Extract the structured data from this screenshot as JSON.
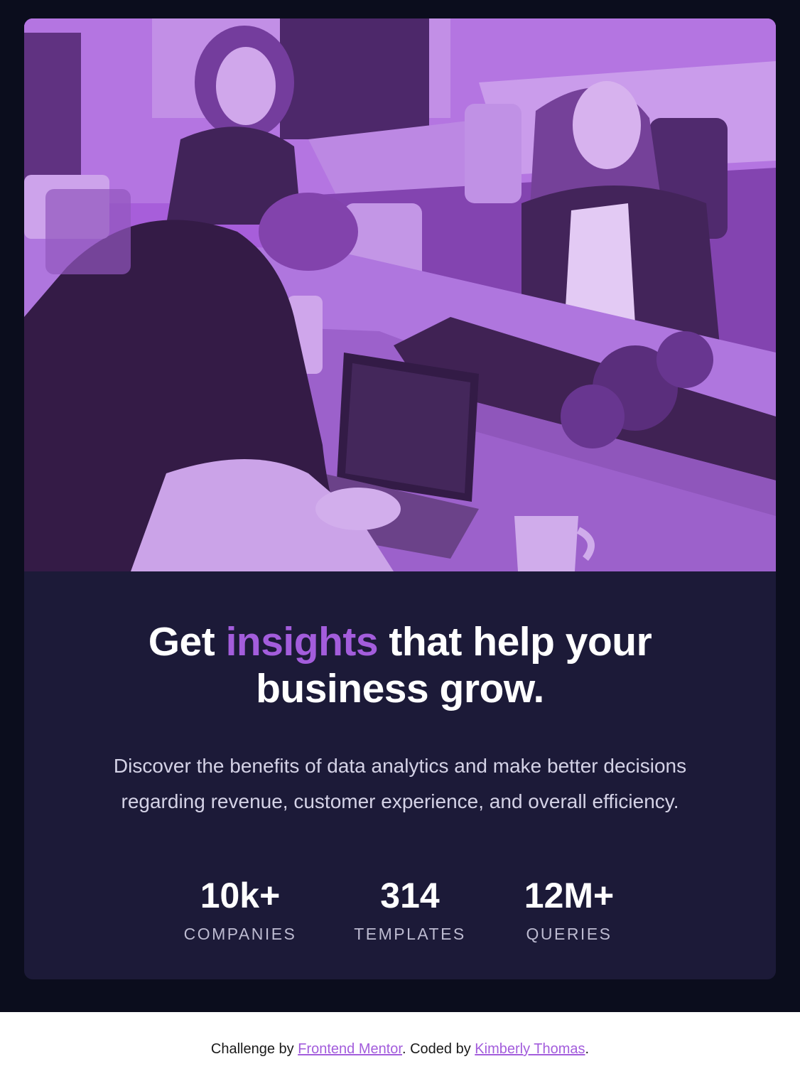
{
  "card": {
    "image_alt": "people working on laptops",
    "headline": {
      "before": "Get ",
      "accent": "insights",
      "after_line1": " that help your",
      "line2": "business grow."
    },
    "lead_line1": "Discover the benefits of data analytics and make better decisions",
    "lead_line2": "regarding revenue, customer experience, and overall efficiency.",
    "stats": [
      {
        "value": "10k+",
        "label": "COMPANIES"
      },
      {
        "value": "314",
        "label": "TEMPLATES"
      },
      {
        "value": "12M+",
        "label": "QUERIES"
      }
    ]
  },
  "footer": {
    "prefix": "Challenge by ",
    "link1": "Frontend Mentor",
    "middle": ". Coded by ",
    "link2": "Kimberly Thomas",
    "suffix": "."
  },
  "colors": {
    "page_background": "#0b0d1d",
    "card_background": "#1c1a38",
    "accent": "#a35ddc",
    "photo_tint": "#a45cd9",
    "text_primary": "#ffffff",
    "text_secondary": "#d4d2e6",
    "stat_label": "#bdbbd1"
  }
}
